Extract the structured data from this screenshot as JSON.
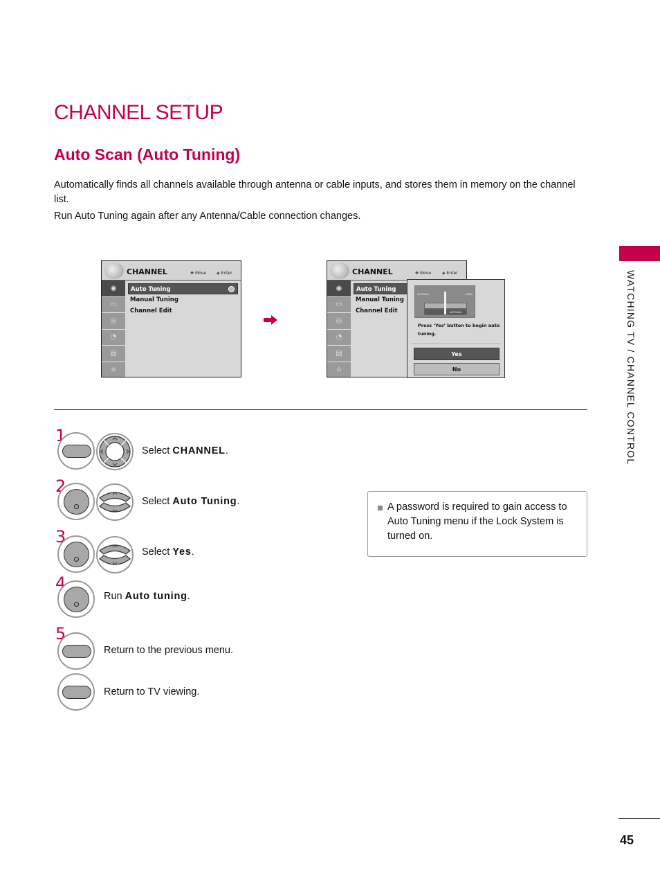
{
  "page": {
    "title": "CHANNEL SETUP",
    "section_title": "Auto Scan (Auto Tuning)",
    "intro": [
      "Automatically finds all channels available through antenna or cable inputs, and stores them in memory on the channel list.",
      "Run Auto Tuning again after any Antenna/Cable connection changes."
    ],
    "side_label": "WATCHING TV / CHANNEL CONTROL",
    "page_number": "45",
    "accent_color": "#c4004e"
  },
  "osd_left": {
    "title": "CHANNEL",
    "hint_move": "Move",
    "hint_enter": "Enter",
    "side_icons": [
      "channel-icon",
      "picture-icon",
      "audio-icon",
      "time-icon",
      "option-icon",
      "lock-icon"
    ],
    "items": [
      {
        "label": "Auto Tuning",
        "selected": true
      },
      {
        "label": "Manual Tuning",
        "selected": false
      },
      {
        "label": "Channel Edit",
        "selected": false
      }
    ]
  },
  "osd_right": {
    "title": "CHANNEL",
    "hint_move": "Move",
    "hint_enter": "Enter",
    "items": [
      {
        "label": "Auto Tuning",
        "selected": true
      },
      {
        "label": "Manual Tuning",
        "selected": false
      },
      {
        "label": "Channel Edit",
        "selected": false
      }
    ],
    "popup": {
      "img_label_antenna": "ANTENNA",
      "img_label_cable": "CABLE",
      "img_label_in": "ANTENNA",
      "message": "Press ‘Yes’ button to begin auto tuning.",
      "yes_label": "Yes",
      "no_label": "No"
    }
  },
  "steps": [
    {
      "num": "1",
      "prefix": "Select ",
      "bold": "CHANNEL",
      "suffix": "."
    },
    {
      "num": "2",
      "prefix": "Select ",
      "bold": "Auto Tuning",
      "suffix": "."
    },
    {
      "num": "3",
      "prefix": "Select ",
      "bold": "Yes",
      "suffix": "."
    },
    {
      "num": "4",
      "prefix": "Run ",
      "bold": "Auto tuning",
      "suffix": "."
    },
    {
      "num": "5",
      "text_a": "Return to the previous menu.",
      "text_b": "Return to TV viewing."
    }
  ],
  "note": {
    "text": "A password is required to gain access to Auto Tuning menu if the Lock System is turned on."
  }
}
